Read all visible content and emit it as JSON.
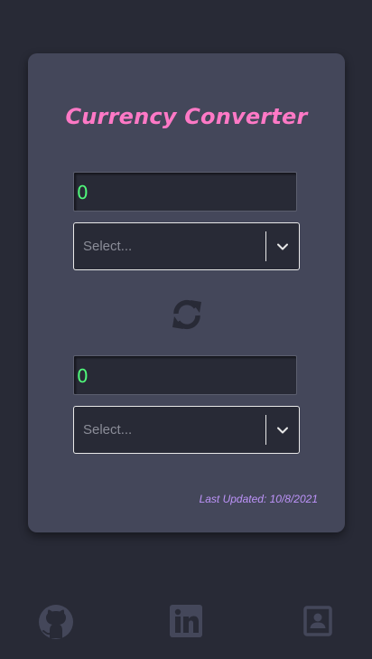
{
  "converter": {
    "title": "Currency Converter",
    "from": {
      "amount": "0",
      "currency_placeholder": "Select..."
    },
    "to": {
      "amount": "0",
      "currency_placeholder": "Select..."
    },
    "swap_icon": "sync-icon",
    "last_updated": "Last Updated: 10/8/2021"
  },
  "footer": {
    "links": [
      {
        "icon": "github-icon"
      },
      {
        "icon": "linkedin-icon"
      },
      {
        "icon": "contact-card-icon"
      }
    ]
  },
  "colors": {
    "background": "#282a36",
    "card": "#44475a",
    "title": "#ff79c6",
    "amount_text": "#50fa7b",
    "updated_text": "#bd93f9"
  }
}
